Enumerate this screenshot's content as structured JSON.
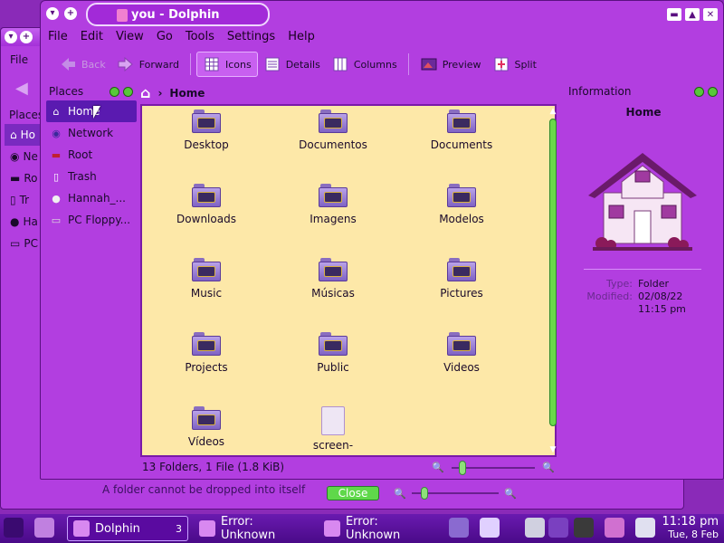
{
  "colors": {
    "window_bg": "#b23ee0",
    "view_bg": "#fde8a8",
    "accent": "#5a1ab0",
    "green": "#58c83a"
  },
  "bg_window": {
    "menu_file": "File",
    "places_header": "Places",
    "items": [
      "Ho",
      "Ne",
      "Ro",
      "Tr",
      "Ha",
      "PC"
    ],
    "status": "A folder cannot be dropped into itself",
    "close_label": "Close"
  },
  "window": {
    "title": "you - Dolphin",
    "menu": [
      "File",
      "Edit",
      "View",
      "Go",
      "Tools",
      "Settings",
      "Help"
    ],
    "toolbar": {
      "back": "Back",
      "forward": "Forward",
      "icons": "Icons",
      "details": "Details",
      "columns": "Columns",
      "preview": "Preview",
      "split": "Split"
    },
    "breadcrumb": "Home"
  },
  "places": {
    "header": "Places",
    "items": [
      {
        "label": "Home",
        "icon": "home-icon"
      },
      {
        "label": "Network",
        "icon": "network-icon"
      },
      {
        "label": "Root",
        "icon": "root-icon"
      },
      {
        "label": "Trash",
        "icon": "trash-icon"
      },
      {
        "label": "Hannah_...",
        "icon": "disc-icon"
      },
      {
        "label": "PC Floppy...",
        "icon": "floppy-icon"
      }
    ]
  },
  "files": [
    {
      "name": "Desktop",
      "type": "folder"
    },
    {
      "name": "Documentos",
      "type": "folder"
    },
    {
      "name": "Documents",
      "type": "folder"
    },
    {
      "name": "Downloads",
      "type": "folder"
    },
    {
      "name": "Imagens",
      "type": "folder"
    },
    {
      "name": "Modelos",
      "type": "folder"
    },
    {
      "name": "Music",
      "type": "folder"
    },
    {
      "name": "Músicas",
      "type": "folder"
    },
    {
      "name": "Pictures",
      "type": "folder"
    },
    {
      "name": "Projects",
      "type": "folder"
    },
    {
      "name": "Public",
      "type": "folder"
    },
    {
      "name": "Videos",
      "type": "folder"
    },
    {
      "name": "Vídeos",
      "type": "folder"
    },
    {
      "name": "screen-",
      "type": "file"
    }
  ],
  "status": "13 Folders, 1 File (1.8 KiB)",
  "info": {
    "header": "Information",
    "name": "Home",
    "type_label": "Type:",
    "type_value": "Folder",
    "modified_label": "Modified:",
    "modified_value": "02/08/22",
    "modified_time": "11:15 pm"
  },
  "taskbar": {
    "tasks": [
      {
        "label": "Dolphin",
        "count": "3"
      },
      {
        "label": "Error: Unknown"
      },
      {
        "label": "Error: Unknown"
      }
    ],
    "time": "11:18 pm",
    "date": "Tue, 8 Feb"
  }
}
